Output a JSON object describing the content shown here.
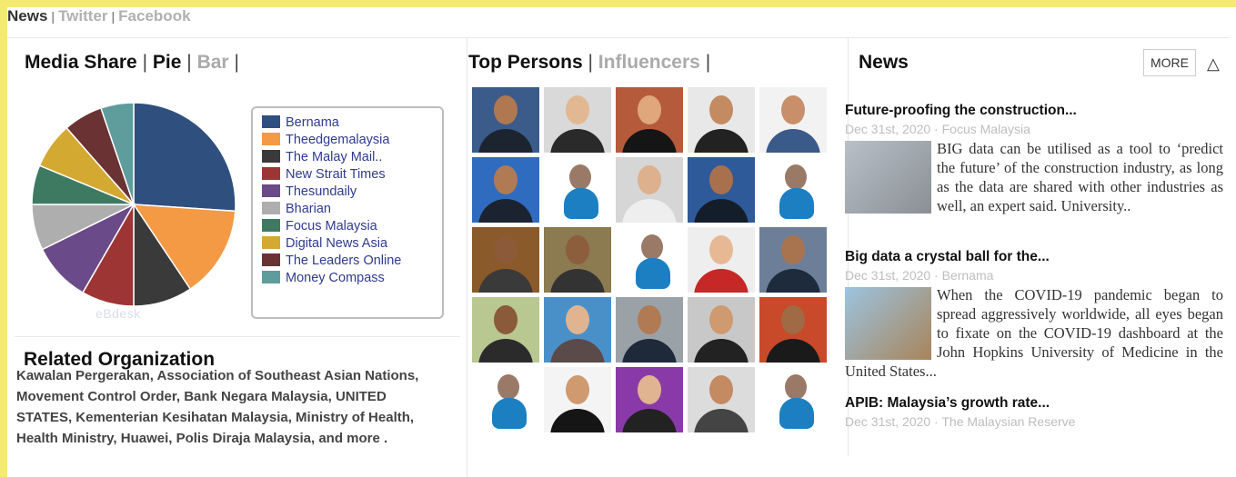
{
  "nav": {
    "tabs": [
      "News",
      "Twitter",
      "Facebook"
    ]
  },
  "media_share": {
    "title": "Media Share",
    "view_pie": "Pie",
    "view_bar": "Bar",
    "legend": [
      {
        "label": "Bernama",
        "color": "#2f4f7f",
        "share": 25.0
      },
      {
        "label": "Theedgemalaysia",
        "color": "#f49a45",
        "share": 14.0
      },
      {
        "label": "The Malay Mail..",
        "color": "#3a3a3a",
        "share": 9.0
      },
      {
        "label": "New Strait Times",
        "color": "#9e3535",
        "share": 8.0
      },
      {
        "label": "Thesundaily",
        "color": "#6a4a88",
        "share": 9.0
      },
      {
        "label": "Bharian",
        "color": "#aeaeae",
        "share": 7.0
      },
      {
        "label": "Focus Malaysia",
        "color": "#3e7a62",
        "share": 6.0
      },
      {
        "label": "Digital News Asia",
        "color": "#d4a932",
        "share": 7.0
      },
      {
        "label": "The Leaders Online",
        "color": "#6a3232",
        "share": 6.0
      },
      {
        "label": "Money Compass",
        "color": "#5f9c9c",
        "share": 5.0
      }
    ],
    "watermark": "eBdesk"
  },
  "related": {
    "title": "Related Organization",
    "text": "Kawalan Pergerakan, Association of Southeast Asian Nations, Movement Control Order, Bank Negara Malaysia, UNITED STATES, Kementerian Kesihatan Malaysia, Ministry of Health, Health Ministry, Huawei, Polis Diraja Malaysia, and more ."
  },
  "persons": {
    "title": "Top Persons",
    "tab_influencers": "Influencers",
    "tiles": [
      {
        "kind": "photo",
        "bg": "#3b5b8a",
        "skin": "#b07850",
        "suit": "#1c2430"
      },
      {
        "kind": "photo",
        "bg": "#d9d9d9",
        "skin": "#e2b893",
        "suit": "#2a2a2a"
      },
      {
        "kind": "photo",
        "bg": "#b65a3c",
        "skin": "#e0a67c",
        "suit": "#151515"
      },
      {
        "kind": "photo",
        "bg": "#e8e8e8",
        "skin": "#c48a62",
        "suit": "#222"
      },
      {
        "kind": "photo",
        "bg": "#f2f2f2",
        "skin": "#c98f6a",
        "suit": "#3a5a8a"
      },
      {
        "kind": "photo",
        "bg": "#2f6cbf",
        "skin": "#b07a55",
        "suit": "#1c2330"
      },
      {
        "kind": "generic"
      },
      {
        "kind": "photo",
        "bg": "#d6d6d6",
        "skin": "#ddb08e",
        "suit": "#eeeeee"
      },
      {
        "kind": "photo",
        "bg": "#2e5a9a",
        "skin": "#a8704c",
        "suit": "#141d2a"
      },
      {
        "kind": "generic"
      },
      {
        "kind": "photo",
        "bg": "#8a5a2a",
        "skin": "#8c5a38",
        "suit": "#3a3a3a"
      },
      {
        "kind": "photo",
        "bg": "#8c7a50",
        "skin": "#8c5e3c",
        "suit": "#333"
      },
      {
        "kind": "generic"
      },
      {
        "kind": "photo",
        "bg": "#eeeeee",
        "skin": "#e6b994",
        "suit": "#c62828"
      },
      {
        "kind": "photo",
        "bg": "#6d7f98",
        "skin": "#a87450",
        "suit": "#1d2b3d"
      },
      {
        "kind": "photo",
        "bg": "#b8c890",
        "skin": "#8a5a3a",
        "suit": "#2b2b2b"
      },
      {
        "kind": "photo",
        "bg": "#4a90c8",
        "skin": "#e0b490",
        "suit": "#5a4a4a"
      },
      {
        "kind": "photo",
        "bg": "#9aa2a8",
        "skin": "#b07a55",
        "suit": "#1e2a3a"
      },
      {
        "kind": "photo",
        "bg": "#c8c8c8",
        "skin": "#d09a70",
        "suit": "#222"
      },
      {
        "kind": "photo",
        "bg": "#c84a2a",
        "skin": "#a06a44",
        "suit": "#1a1a1a"
      },
      {
        "kind": "generic"
      },
      {
        "kind": "photo",
        "bg": "#f4f4f4",
        "skin": "#d09a70",
        "suit": "#151515"
      },
      {
        "kind": "photo",
        "bg": "#8a3aa8",
        "skin": "#e0b490",
        "suit": "#222"
      },
      {
        "kind": "photo",
        "bg": "#dcdcdc",
        "skin": "#c48a62",
        "suit": "#444"
      },
      {
        "kind": "generic"
      }
    ]
  },
  "news": {
    "title": "News",
    "more_label": "MORE",
    "collapse_icon": "△",
    "items": [
      {
        "title": "Future-proofing the construction...",
        "meta": "Dec 31st, 2020 · Focus Malaysia",
        "body": "BIG data can be utilised as a tool to ‘predict the future’ of the construction industry, as long as the data are shared with other industries as well, an expert said. University..",
        "thumb_colors": [
          "#b8c0c8",
          "#8a8f95"
        ]
      },
      {
        "title": "Big data a crystal ball for the...",
        "meta": "Dec 31st, 2020 · Bernama",
        "body": "When the COVID-19 pandemic began to spread aggressively worldwide, all eyes began to fixate on the COVID-19 dashboard at the John Hopkins University of Medicine in the United States...",
        "thumb_colors": [
          "#9cc4e0",
          "#a8845a"
        ]
      },
      {
        "title": "APIB: Malaysia’s growth rate...",
        "meta": "Dec 31st, 2020 · The Malaysian Reserve",
        "body": ""
      }
    ]
  }
}
